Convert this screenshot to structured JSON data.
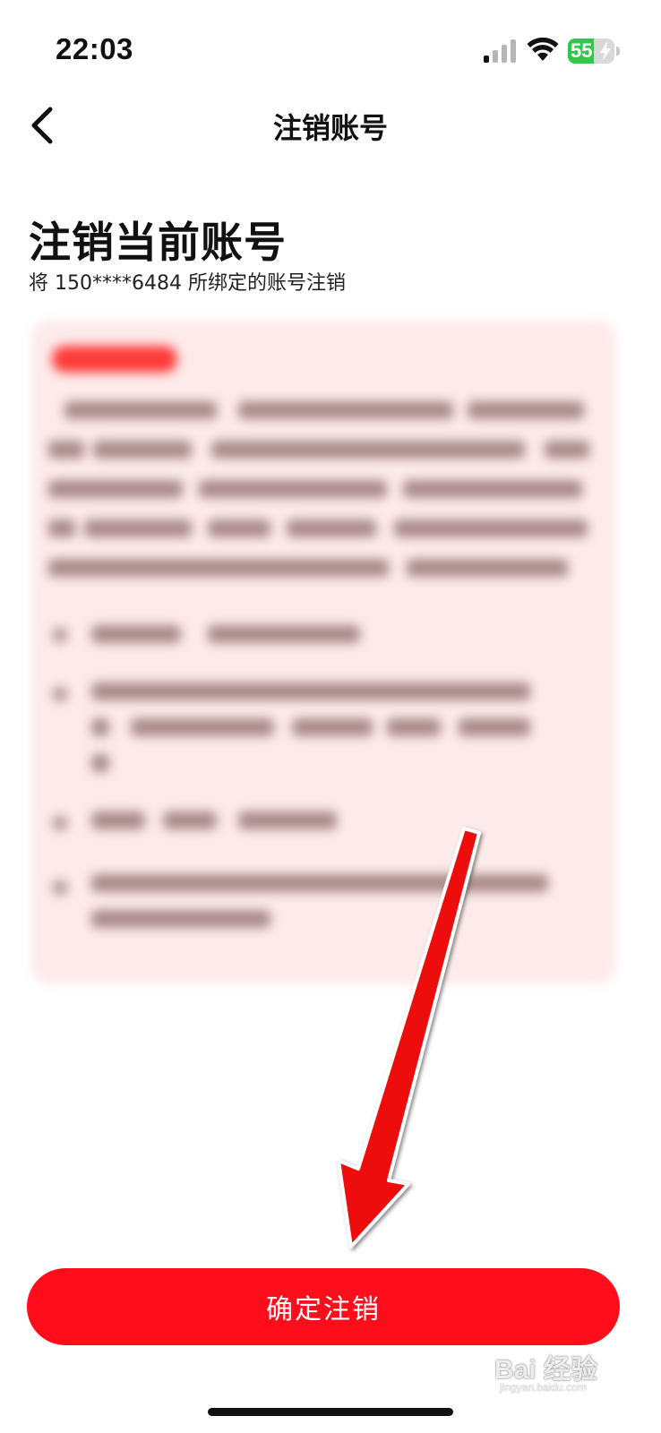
{
  "status_bar": {
    "time": "22:03",
    "battery_level": "55",
    "battery_fraction": 0.55,
    "signal_icon": "cellular-signal-icon",
    "wifi_icon": "wifi-icon",
    "battery_icon": "battery-charging-icon"
  },
  "nav": {
    "title": "注销账号",
    "back_icon": "chevron-left-icon"
  },
  "main": {
    "heading": "注销当前账号",
    "subtitle": "将 150****6484 所绑定的账号注销"
  },
  "confirm_button": {
    "label": "确定注销"
  },
  "watermark": {
    "text": "Bai 经验",
    "sub": "jingyan.baidu.com"
  },
  "colors": {
    "accent": "#ff0d1a",
    "card_background": "#fdeaea",
    "battery_green": "#32c74b"
  }
}
